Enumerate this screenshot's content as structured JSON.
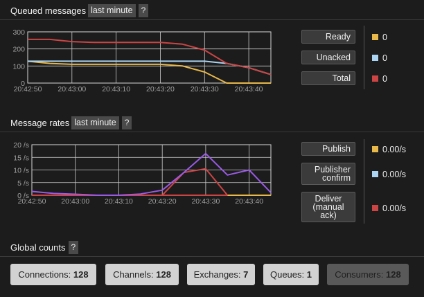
{
  "queued": {
    "title": "Queued messages",
    "range": "last minute",
    "help": "?",
    "ylabels": [
      "300",
      "200",
      "100",
      "0"
    ],
    "xlabels": [
      "20:42:50",
      "20:43:00",
      "20:43:10",
      "20:43:20",
      "20:43:30",
      "20:43:40"
    ],
    "legend": [
      {
        "label": "Ready",
        "value": "0",
        "color": "#e8b84a"
      },
      {
        "label": "Unacked",
        "value": "0",
        "color": "#aad4f2"
      },
      {
        "label": "Total",
        "value": "0",
        "color": "#cc4444"
      }
    ]
  },
  "rates": {
    "title": "Message rates",
    "range": "last minute",
    "help": "?",
    "ylabels": [
      "20 /s",
      "15 /s",
      "10 /s",
      "5 /s",
      "0 /s"
    ],
    "xlabels": [
      "20:42:50",
      "20:43:00",
      "20:43:10",
      "20:43:20",
      "20:43:30",
      "20:43:40"
    ],
    "legend": [
      {
        "label1": "Publish",
        "label2": "",
        "label3": "",
        "value": "0.00/s",
        "color": "#e8b84a"
      },
      {
        "label1": "Publisher",
        "label2": "confirm",
        "label3": "",
        "value": "0.00/s",
        "color": "#aad4f2"
      },
      {
        "label1": "Deliver",
        "label2": "(manual",
        "label3": "ack)",
        "value": "0.00/s",
        "color": "#cc4444"
      }
    ]
  },
  "global": {
    "title": "Global counts",
    "help": "?",
    "counts": [
      {
        "label": "Connections:",
        "value": "128"
      },
      {
        "label": "Channels:",
        "value": "128"
      },
      {
        "label": "Exchanges:",
        "value": "7"
      },
      {
        "label": "Queues:",
        "value": "1"
      },
      {
        "label": "Consumers:",
        "value": "128"
      }
    ]
  },
  "chart_data": [
    {
      "type": "line",
      "title": "Queued messages",
      "x": [
        "20:42:50",
        "20:42:55",
        "20:43:00",
        "20:43:05",
        "20:43:10",
        "20:43:15",
        "20:43:20",
        "20:43:25",
        "20:43:30",
        "20:43:35",
        "20:43:40",
        "20:43:45"
      ],
      "ylim": [
        0,
        300
      ],
      "xlabels": [
        "20:42:50",
        "20:43:00",
        "20:43:10",
        "20:43:20",
        "20:43:30",
        "20:43:40"
      ],
      "series": [
        {
          "name": "Ready",
          "color": "#e8b84a",
          "values": [
            128,
            115,
            110,
            110,
            110,
            110,
            110,
            100,
            65,
            0,
            0,
            0
          ]
        },
        {
          "name": "Unacked",
          "color": "#aad4f2",
          "values": [
            128,
            128,
            128,
            128,
            128,
            128,
            128,
            128,
            128,
            115,
            90,
            50
          ]
        },
        {
          "name": "Total",
          "color": "#cc4444",
          "values": [
            256,
            256,
            243,
            238,
            238,
            238,
            238,
            228,
            193,
            115,
            90,
            50
          ]
        }
      ],
      "grid": true
    },
    {
      "type": "line",
      "title": "Message rates",
      "x": [
        "20:42:50",
        "20:42:55",
        "20:43:00",
        "20:43:05",
        "20:43:10",
        "20:43:15",
        "20:43:20",
        "20:43:25",
        "20:43:30",
        "20:43:35",
        "20:43:40",
        "20:43:45"
      ],
      "ylim": [
        0,
        20
      ],
      "xlabels": [
        "20:42:50",
        "20:43:00",
        "20:43:10",
        "20:43:20",
        "20:43:30",
        "20:43:40"
      ],
      "series": [
        {
          "name": "Publish",
          "color": "#e8b84a",
          "values": [
            0,
            0,
            0,
            0,
            0,
            0,
            0,
            0,
            0,
            0,
            0,
            0
          ]
        },
        {
          "name": "Deliver (manual ack)",
          "color": "#cc4444",
          "values": [
            0,
            0,
            0,
            0,
            0,
            0,
            0,
            0,
            0,
            0,
            null,
            null
          ]
        },
        {
          "name": "Deliver (manual ack)",
          "color": "#cc4444",
          "values": [
            null,
            null,
            null,
            null,
            null,
            null,
            0,
            9,
            10.5,
            0,
            null,
            null
          ]
        },
        {
          "name": "",
          "color": "#9b59e8",
          "values": [
            1.5,
            0.7,
            0.4,
            0,
            0,
            0.5,
            2,
            9,
            16.5,
            8,
            10,
            1
          ]
        }
      ],
      "grid": true
    }
  ]
}
